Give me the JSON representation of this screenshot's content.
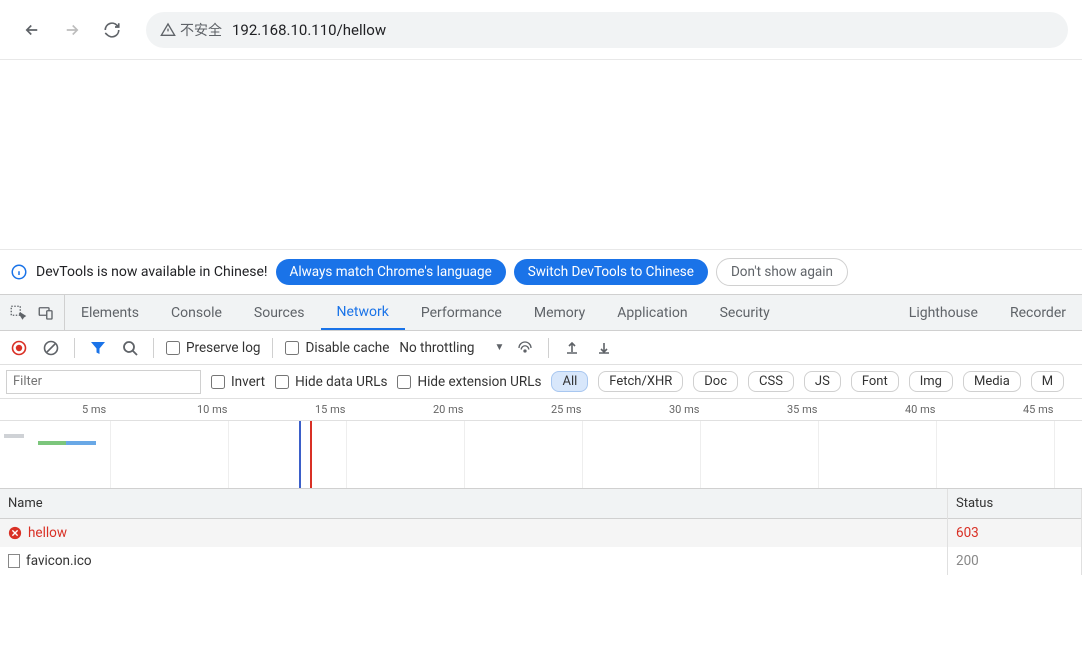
{
  "browser": {
    "security_label": "不安全",
    "url": "192.168.10.110/hellow"
  },
  "lang_notice": {
    "text": "DevTools is now available in Chinese!",
    "btn_match": "Always match Chrome's language",
    "btn_switch": "Switch DevTools to Chinese",
    "btn_dismiss": "Don't show again"
  },
  "tabs": {
    "elements": "Elements",
    "console": "Console",
    "sources": "Sources",
    "network": "Network",
    "performance": "Performance",
    "memory": "Memory",
    "application": "Application",
    "security": "Security",
    "lighthouse": "Lighthouse",
    "recorder": "Recorder"
  },
  "net_toolbar": {
    "preserve_log": "Preserve log",
    "disable_cache": "Disable cache",
    "throttling": "No throttling"
  },
  "filter": {
    "placeholder": "Filter",
    "invert": "Invert",
    "hide_data": "Hide data URLs",
    "hide_ext": "Hide extension URLs",
    "chips": {
      "all": "All",
      "fetch": "Fetch/XHR",
      "doc": "Doc",
      "css": "CSS",
      "js": "JS",
      "font": "Font",
      "img": "Img",
      "media": "Media",
      "m": "M"
    }
  },
  "timeline": {
    "ticks": [
      "5 ms",
      "10 ms",
      "15 ms",
      "20 ms",
      "25 ms",
      "30 ms",
      "35 ms",
      "40 ms",
      "45 ms"
    ]
  },
  "table": {
    "headers": {
      "name": "Name",
      "status": "Status"
    },
    "rows": [
      {
        "name": "hellow",
        "status": "603",
        "error": true
      },
      {
        "name": "favicon.ico",
        "status": "200",
        "error": false
      }
    ]
  }
}
